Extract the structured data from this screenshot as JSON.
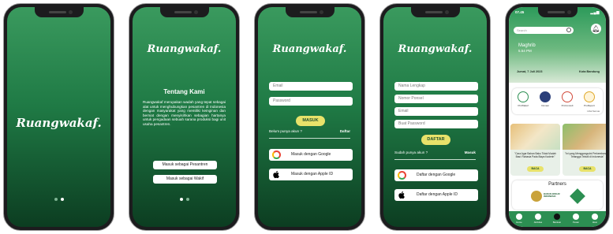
{
  "brand": "Ruangwakaf.",
  "splash": {
    "dots": [
      false,
      true
    ]
  },
  "about": {
    "title": "Tentang Kami",
    "text": "Ruangwakaf merupakan wadah yang tepat sebagai alat untuk menghubungkan pesantren di Indonesia dengan masyarakat yang memiliki keinginan dan berniat dengan menyisihkan sebagian hartanya untuk pengadaan sebuah sarana produksi bagi unit usaha pesantren.",
    "btn_pesantren": "Masuk sebagai Pesantren",
    "btn_wakif": "Masuk sebagai Wakif",
    "dots": [
      true,
      false
    ]
  },
  "login": {
    "email": "Email",
    "password": "Password",
    "submit": "MASUK",
    "prompt": "Belum punya akun ?",
    "link": "Daftar",
    "google": "Masuk dengan Google",
    "apple": "Masuk dengan Apple ID"
  },
  "register": {
    "name": "Nama Lengkap",
    "phone": "Nomor Ponsel",
    "email": "Email",
    "password": "Buat Password",
    "submit": "DAFTAR",
    "prompt": "Sudah punya akun ?",
    "link": "Masuk",
    "google": "Daftar dengan Google",
    "apple": "Daftar dengan Apple ID"
  },
  "home": {
    "time": "07.45",
    "search_placeholder": "Search",
    "prayer_name": "Maghrib",
    "prayer_time": "5.54 PM",
    "date": "Jumat, 7 Juli 2023",
    "city": "Kota Bandung",
    "menu": [
      "ProWakaf",
      "Donasi",
      "ProConsult",
      "ProReport"
    ],
    "lihat_semua": "Lihat Semua",
    "cards": [
      {
        "caption": "\"Cara Agar Bahan Baku Tidak Mudah Basi: Rahasia Pada Biaya Kaderin\"",
        "cta": "BACA"
      },
      {
        "caption": "\"Ini yang Menggangudni Perkembangan Tetangga Tekstil di Indonesia\"",
        "cta": "BACA"
      }
    ],
    "partners_title": "Partners",
    "partner_name": "BADAN WAKAF INDONESIA",
    "tabs": [
      "Home",
      "Aktivitas",
      "Bantuan",
      "Pesan",
      "Akun"
    ]
  },
  "colors": {
    "green": "#1f7a45",
    "dark_green": "#0c3d21",
    "accent": "#e8e26a"
  }
}
